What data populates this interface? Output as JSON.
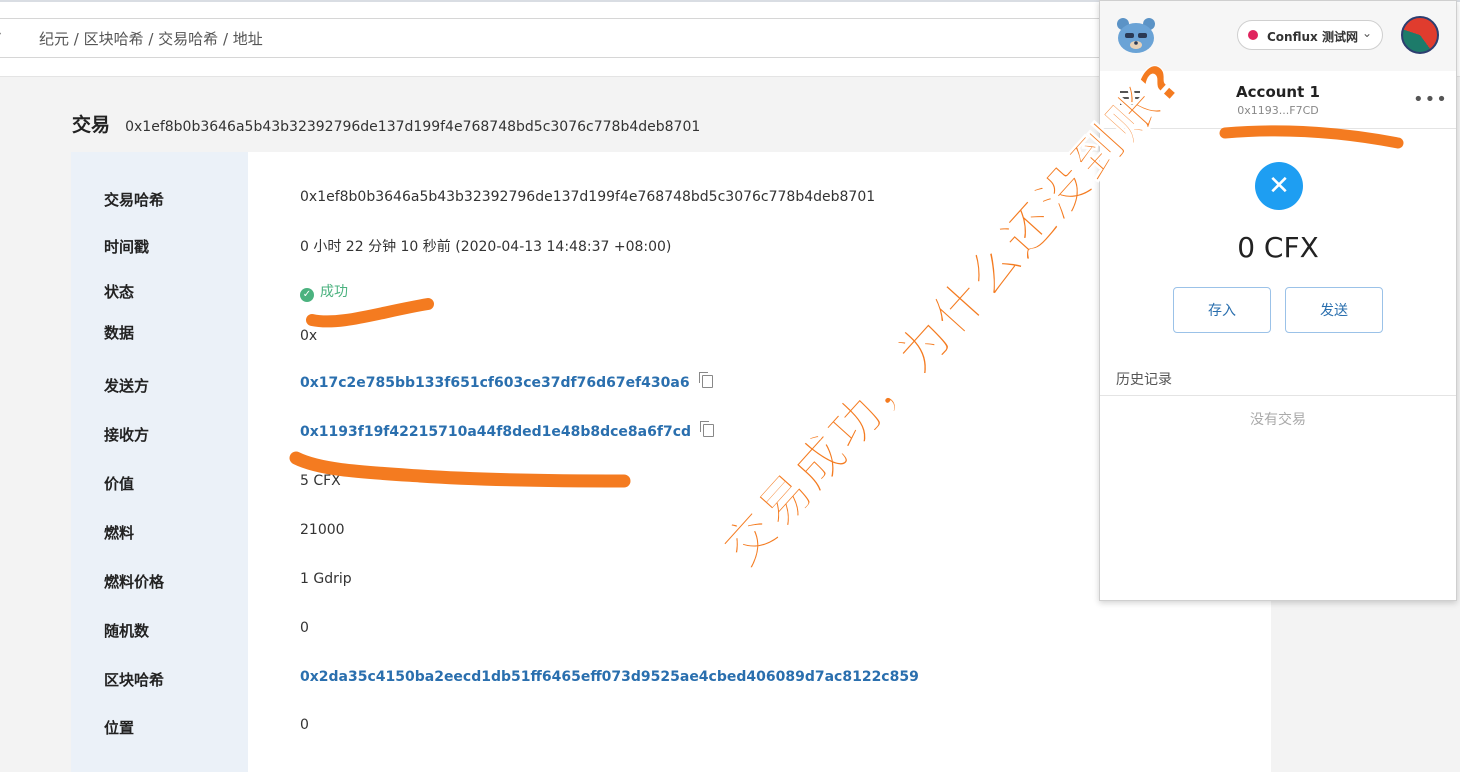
{
  "breadcrumb": {
    "text": "纪元 / 区块哈希 / 交易哈希 / 地址"
  },
  "page": {
    "label": "交易",
    "hash": "0x1ef8b0b3646a5b43b32392796de137d199f4e768748bd5c3076c778b4deb8701"
  },
  "details": {
    "rows": [
      {
        "key": "交易哈希",
        "value": "0x1ef8b0b3646a5b43b32392796de137d199f4e768748bd5c3076c778b4deb8701"
      },
      {
        "key": "时间戳",
        "value": "0 小时 22 分钟 10 秒前  (2020-04-13 14:48:37 +08:00)"
      },
      {
        "key": "状态",
        "value": "成功"
      },
      {
        "key": "数据",
        "value": "0x"
      },
      {
        "key": "发送方",
        "value": "0x17c2e785bb133f651cf603ce37df76d67ef430a6"
      },
      {
        "key": "接收方",
        "value": "0x1193f19f42215710a44f8ded1e48b8dce8a6f7cd"
      },
      {
        "key": "价值",
        "value": "5 CFX"
      },
      {
        "key": "燃料",
        "value": "21000"
      },
      {
        "key": "燃料价格",
        "value": "1 Gdrip"
      },
      {
        "key": "随机数",
        "value": "0"
      },
      {
        "key": "区块哈希",
        "value": "0x2da35c4150ba2eecd1db51ff6465eff073d9525ae4cbed406089d7ac8122c859"
      },
      {
        "key": "位置",
        "value": "0"
      }
    ]
  },
  "wallet": {
    "network": "Conflux 测试网",
    "account_name": "Account 1",
    "account_addr": "0x1193...F7CD",
    "balance": "0 CFX",
    "deposit": "存入",
    "send": "发送",
    "history_label": "历史记录",
    "no_tx": "没有交易",
    "colors": {
      "accent": "#2a6fae",
      "network_dot": "#e0245e"
    }
  },
  "annotation": {
    "text": "交易成功，为什么还没到账?",
    "color": "#f47b20"
  },
  "colors": {
    "success": "#4bb27f",
    "link": "#2a6fae",
    "label_bg": "#ebf1f8"
  }
}
